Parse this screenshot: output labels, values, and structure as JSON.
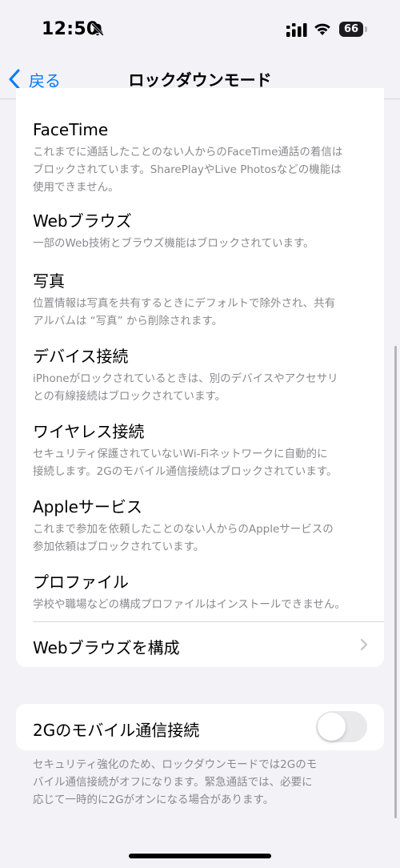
{
  "status_bar": {
    "time": "12:50",
    "battery": "66",
    "icons": [
      "bell-slash-icon",
      "cellular-signal-icon",
      "wifi-icon",
      "battery-icon"
    ]
  },
  "nav": {
    "back_label": "戻る",
    "title": "ロックダウンモード"
  },
  "sections": [
    {
      "title": "FaceTime",
      "description": "これまでに通話したことのない人からのFaceTime通話の着信は\nブロックされています。SharePlayやLive Photosなどの機能は\n使用できません。"
    },
    {
      "title": "Webブラウズ",
      "description": "一部のWeb技術とブラウズ機能はブロックされています。"
    },
    {
      "title": "写真",
      "description": "位置情報は写真を共有するときにデフォルトで除外され、共有\nアルバムは “写真” から削除されます。"
    },
    {
      "title": "デバイス接続",
      "description": "iPhoneがロックされているときは、別のデバイスやアクセサリ\nとの有線接続はブロックされています。"
    },
    {
      "title": "ワイヤレス接続",
      "description": "セキュリティ保護されていないWi-Fiネットワークに自動的に\n接続します。2Gのモバイル通信接続はブロックされています。"
    },
    {
      "title": "Appleサービス",
      "description": "これまで参加を依頼したことのない人からのAppleサービスの\n参加依頼はブロックされています。"
    },
    {
      "title": "プロファイル",
      "description": "学校や職場などの構成プロファイルはインストールできません。"
    }
  ],
  "configure_web": {
    "label": "Webブラウズを構成"
  },
  "toggle_2g": {
    "label": "2Gのモバイル通信接続",
    "enabled": false
  },
  "footer_note": "セキュリティ強化のため、ロックダウンモードでは2Gのモ\nバイル通信接続がオフになります。緊急通話では、必要に\n応じて一時的に2Gがオンになる場合があります。"
}
